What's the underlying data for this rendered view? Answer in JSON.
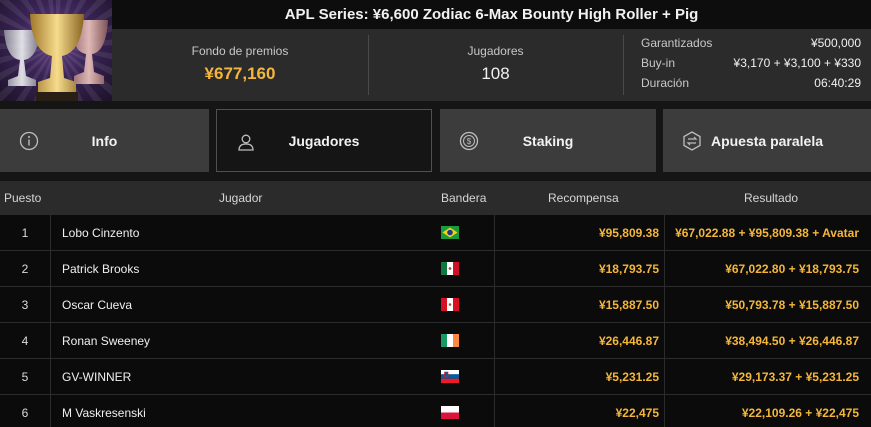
{
  "header": {
    "title": "APL Series: ¥6,600 Zodiac 6-Max Bounty High Roller + Pig"
  },
  "stats": {
    "prize_label": "Fondo de premios",
    "prize_value": "¥677,160",
    "players_label": "Jugadores",
    "players_value": "108",
    "details": [
      {
        "key": "Garantizados",
        "value": "¥500,000"
      },
      {
        "key": "Buy-in",
        "value": "¥3,170 + ¥3,100 + ¥330"
      },
      {
        "key": "Duración",
        "value": "06:40:29"
      }
    ]
  },
  "tabs": [
    {
      "label": "Info",
      "icon": "info-icon",
      "active": false
    },
    {
      "label": "Jugadores",
      "icon": "user-icon",
      "active": true
    },
    {
      "label": "Staking",
      "icon": "coin-icon",
      "active": false
    },
    {
      "label": "Apuesta paralela",
      "icon": "side-bet-icon",
      "active": false
    }
  ],
  "table": {
    "columns": [
      "Puesto",
      "Jugador",
      "Bandera",
      "Recompensa",
      "Resultado"
    ],
    "rows": [
      {
        "pos": "1",
        "name": "Lobo Cinzento",
        "flag": "brazil-flag",
        "reward": "¥95,809.38",
        "result": "¥67,022.88 + ¥95,809.38 + Avatar"
      },
      {
        "pos": "2",
        "name": "Patrick Brooks",
        "flag": "mexico-flag",
        "reward": "¥18,793.75",
        "result": "¥67,022.80 + ¥18,793.75"
      },
      {
        "pos": "3",
        "name": "Oscar Cueva",
        "flag": "peru-flag",
        "reward": "¥15,887.50",
        "result": "¥50,793.78 + ¥15,887.50"
      },
      {
        "pos": "4",
        "name": "Ronan Sweeney",
        "flag": "ireland-flag",
        "reward": "¥26,446.87",
        "result": "¥38,494.50 + ¥26,446.87"
      },
      {
        "pos": "5",
        "name": "GV-WINNER",
        "flag": "slovenia-flag",
        "reward": "¥5,231.25",
        "result": "¥29,173.37 + ¥5,231.25"
      },
      {
        "pos": "6",
        "name": "M Vaskresenski",
        "flag": "poland-flag",
        "reward": "¥22,475",
        "result": "¥22,109.26 + ¥22,475"
      }
    ]
  },
  "colors": {
    "accent_gold": "#f4b63b",
    "panel": "#2b2b2b",
    "tab": "#3c3c3c",
    "background": "#151515"
  }
}
